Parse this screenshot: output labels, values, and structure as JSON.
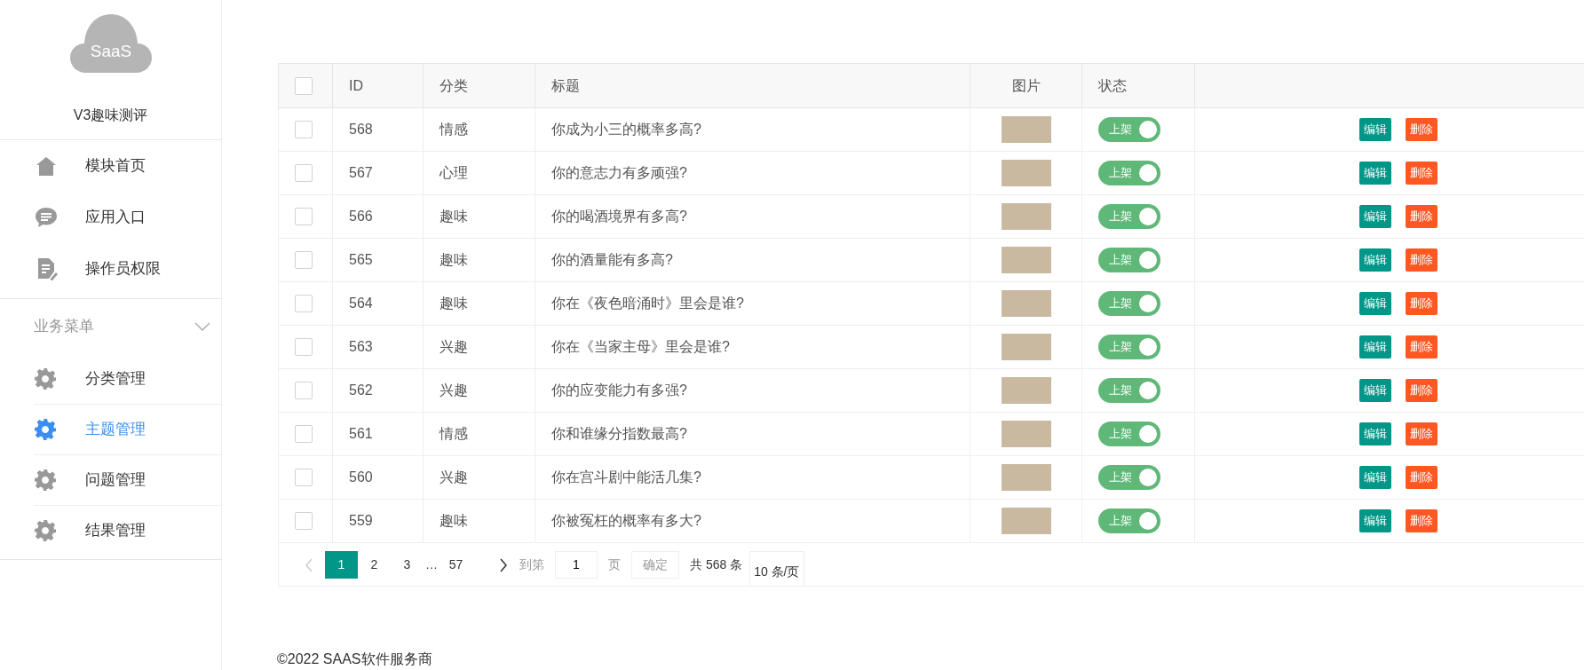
{
  "sidebar": {
    "logo_text": "SaaS",
    "app_name": "V3趣味测评",
    "items": [
      {
        "label": "模块首页",
        "kind": "home"
      },
      {
        "label": "应用入口",
        "kind": "chat"
      },
      {
        "label": "操作员权限",
        "kind": "doc"
      }
    ],
    "section": {
      "title": "业务菜单",
      "expanded": true,
      "items": [
        {
          "label": "分类管理",
          "selected": false
        },
        {
          "label": "主题管理",
          "selected": true
        },
        {
          "label": "问题管理",
          "selected": false
        },
        {
          "label": "结果管理",
          "selected": false
        }
      ]
    }
  },
  "table": {
    "header_checked": false,
    "columns": [
      "ID",
      "分类",
      "标题",
      "图片",
      "状态"
    ],
    "rows": [
      {
        "checked": false,
        "id": "568",
        "category": "情感",
        "title": "你成为小三的概率多高?",
        "status": {
          "on": true,
          "label": "上架"
        },
        "actions": [
          "编辑",
          "删除"
        ]
      },
      {
        "checked": false,
        "id": "567",
        "category": "心理",
        "title": "你的意志力有多顽强?",
        "status": {
          "on": true,
          "label": "上架"
        },
        "actions": [
          "编辑",
          "删除"
        ]
      },
      {
        "checked": false,
        "id": "566",
        "category": "趣味",
        "title": "你的喝酒境界有多高?",
        "status": {
          "on": true,
          "label": "上架"
        },
        "actions": [
          "编辑",
          "删除"
        ]
      },
      {
        "checked": false,
        "id": "565",
        "category": "趣味",
        "title": "你的酒量能有多高?",
        "status": {
          "on": true,
          "label": "上架"
        },
        "actions": [
          "编辑",
          "删除"
        ]
      },
      {
        "checked": false,
        "id": "564",
        "category": "趣味",
        "title": "你在《夜色暗涌时》里会是谁?",
        "status": {
          "on": true,
          "label": "上架"
        },
        "actions": [
          "编辑",
          "删除"
        ]
      },
      {
        "checked": false,
        "id": "563",
        "category": "兴趣",
        "title": "你在《当家主母》里会是谁?",
        "status": {
          "on": true,
          "label": "上架"
        },
        "actions": [
          "编辑",
          "删除"
        ]
      },
      {
        "checked": false,
        "id": "562",
        "category": "兴趣",
        "title": "你的应变能力有多强?",
        "status": {
          "on": true,
          "label": "上架"
        },
        "actions": [
          "编辑",
          "删除"
        ]
      },
      {
        "checked": false,
        "id": "561",
        "category": "情感",
        "title": "你和谁缘分指数最高?",
        "status": {
          "on": true,
          "label": "上架"
        },
        "actions": [
          "编辑",
          "删除"
        ]
      },
      {
        "checked": false,
        "id": "560",
        "category": "兴趣",
        "title": "你在宫斗剧中能活几集?",
        "status": {
          "on": true,
          "label": "上架"
        },
        "actions": [
          "编辑",
          "删除"
        ]
      },
      {
        "checked": false,
        "id": "559",
        "category": "趣味",
        "title": "你被冤枉的概率有多大?",
        "status": {
          "on": true,
          "label": "上架"
        },
        "actions": [
          "编辑",
          "删除"
        ]
      }
    ]
  },
  "pagination": {
    "prev_disabled": true,
    "pages": [
      {
        "label": "1",
        "selected": true
      },
      {
        "label": "2",
        "selected": false
      },
      {
        "label": "3",
        "selected": false
      }
    ],
    "ellipsis": "…",
    "last_page": {
      "label": "57",
      "selected": false
    },
    "goto_label": "到第",
    "goto_value": "1",
    "page_unit": "页",
    "confirm": "确定",
    "total": "共 568 条",
    "page_size": "10 条/页"
  },
  "footer": "©2022 SAAS软件服务商"
}
